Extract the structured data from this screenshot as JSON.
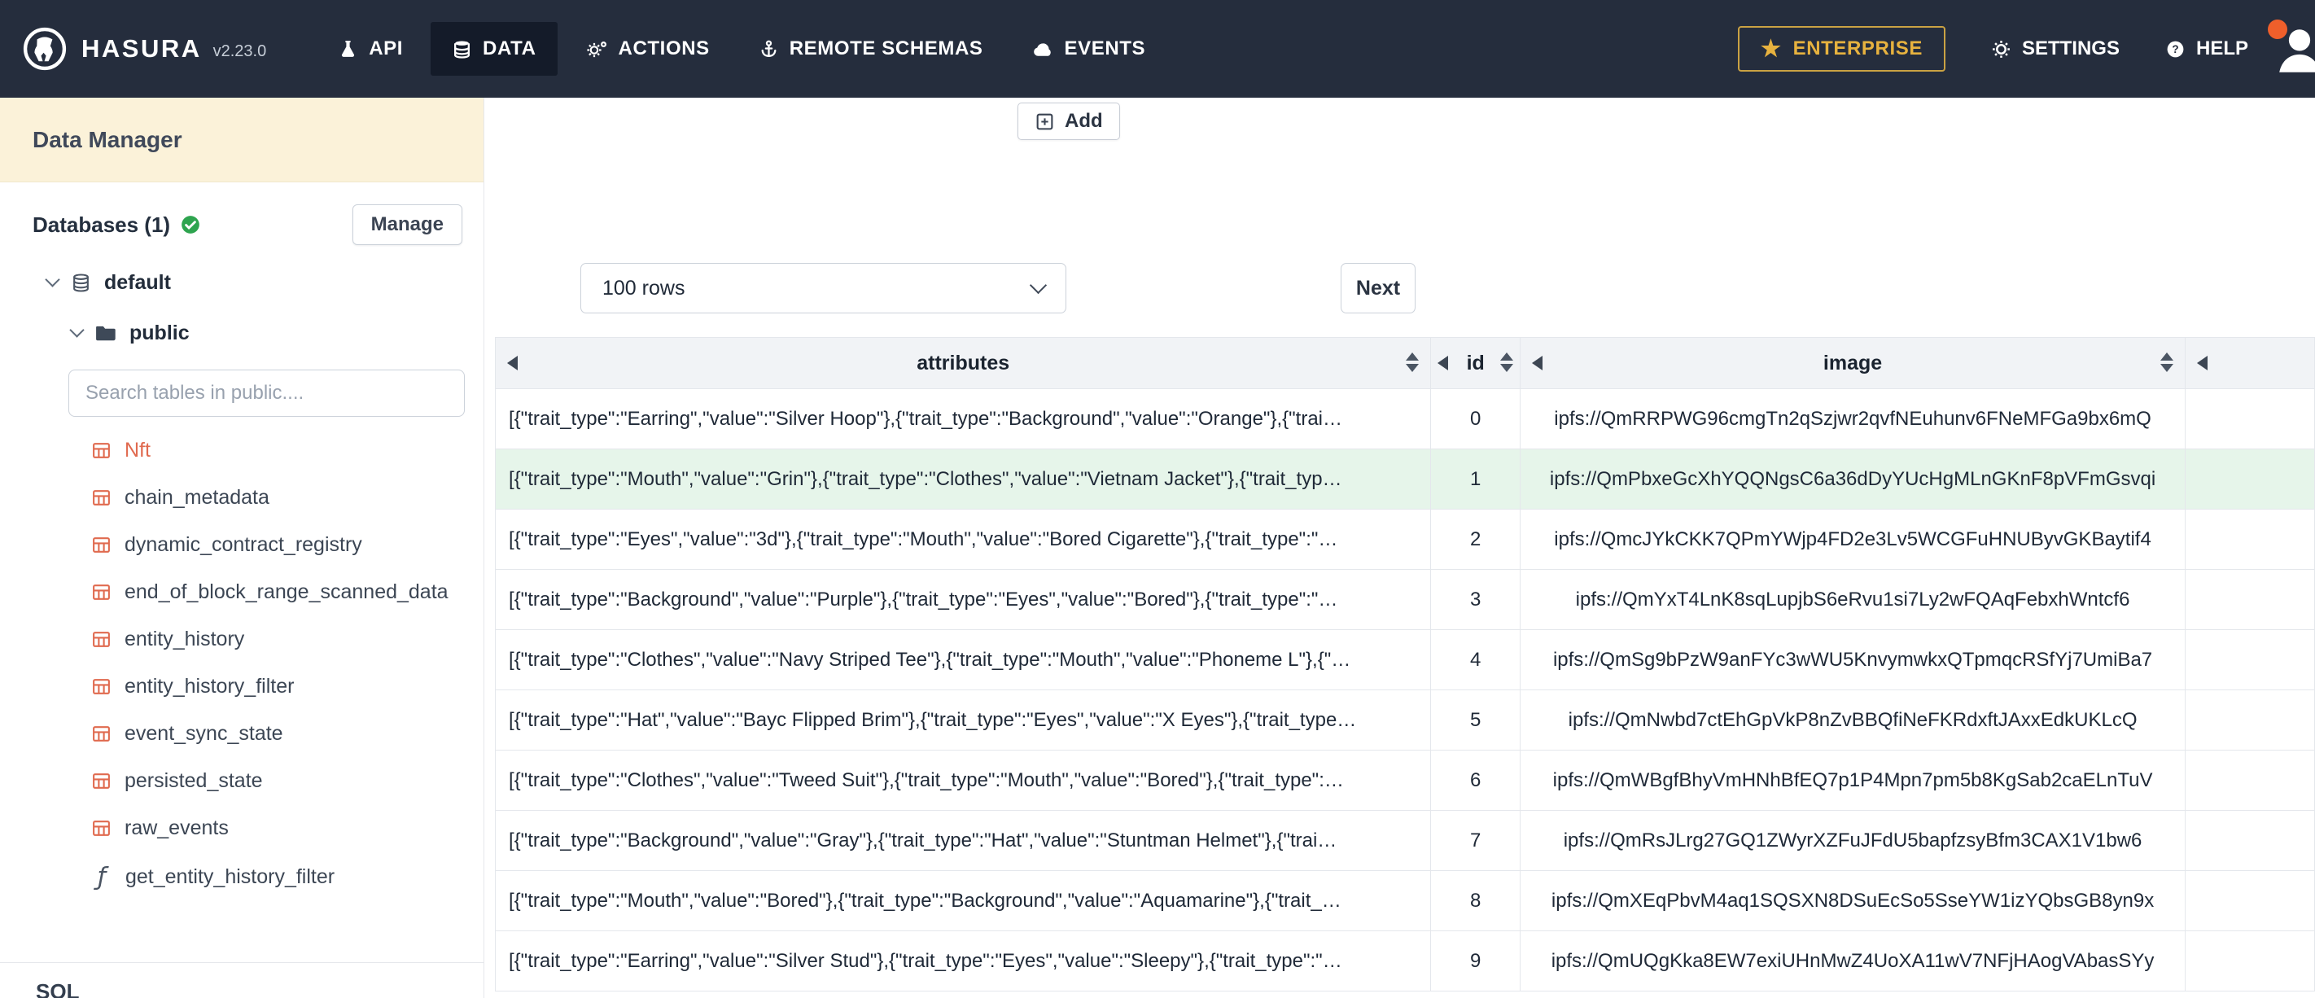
{
  "navbar": {
    "brand": "HASURA",
    "version": "v2.23.0",
    "items": [
      {
        "label": "API"
      },
      {
        "label": "DATA"
      },
      {
        "label": "ACTIONS"
      },
      {
        "label": "REMOTE SCHEMAS"
      },
      {
        "label": "EVENTS"
      }
    ],
    "enterprise": "ENTERPRISE",
    "settings": "SETTINGS",
    "help": "HELP"
  },
  "sidebar": {
    "title": "Data Manager",
    "databases_label": "Databases (1)",
    "manage_button": "Manage",
    "database_name": "default",
    "schema_name": "public",
    "search_placeholder": "Search tables in public....",
    "tables": [
      {
        "name": "Nft",
        "active": true
      },
      {
        "name": "chain_metadata"
      },
      {
        "name": "dynamic_contract_registry"
      },
      {
        "name": "end_of_block_range_scanned_data"
      },
      {
        "name": "entity_history"
      },
      {
        "name": "entity_history_filter"
      },
      {
        "name": "event_sync_state"
      },
      {
        "name": "persisted_state"
      },
      {
        "name": "raw_events"
      }
    ],
    "function_glyph": "ƒ",
    "function_name": "get_entity_history_filter",
    "sql_label": "SQL"
  },
  "content": {
    "add_button": "Add",
    "rows_per_page": "100 rows",
    "next_button": "Next",
    "table": {
      "columns": [
        "attributes",
        "id",
        "image"
      ],
      "highlighted_row_id": "1",
      "rows": [
        {
          "attributes": "[{\"trait_type\":\"Earring\",\"value\":\"Silver Hoop\"},{\"trait_type\":\"Background\",\"value\":\"Orange\"},{\"trai…",
          "id": "0",
          "image": "ipfs://QmRRPWG96cmgTn2qSzjwr2qvfNEuhunv6FNeMFGa9bx6mQ"
        },
        {
          "attributes": "[{\"trait_type\":\"Mouth\",\"value\":\"Grin\"},{\"trait_type\":\"Clothes\",\"value\":\"Vietnam Jacket\"},{\"trait_typ…",
          "id": "1",
          "image": "ipfs://QmPbxeGcXhYQQNgsC6a36dDyYUcHgMLnGKnF8pVFmGsvqi"
        },
        {
          "attributes": "[{\"trait_type\":\"Eyes\",\"value\":\"3d\"},{\"trait_type\":\"Mouth\",\"value\":\"Bored Cigarette\"},{\"trait_type\":\"…",
          "id": "2",
          "image": "ipfs://QmcJYkCKK7QPmYWjp4FD2e3Lv5WCGFuHNUByvGKBaytif4"
        },
        {
          "attributes": "[{\"trait_type\":\"Background\",\"value\":\"Purple\"},{\"trait_type\":\"Eyes\",\"value\":\"Bored\"},{\"trait_type\":\"…",
          "id": "3",
          "image": "ipfs://QmYxT4LnK8sqLupjbS6eRvu1si7Ly2wFQAqFebxhWntcf6"
        },
        {
          "attributes": "[{\"trait_type\":\"Clothes\",\"value\":\"Navy Striped Tee\"},{\"trait_type\":\"Mouth\",\"value\":\"Phoneme L\"},{\"…",
          "id": "4",
          "image": "ipfs://QmSg9bPzW9anFYc3wWU5KnvymwkxQTpmqcRSfYj7UmiBa7"
        },
        {
          "attributes": "[{\"trait_type\":\"Hat\",\"value\":\"Bayc Flipped Brim\"},{\"trait_type\":\"Eyes\",\"value\":\"X Eyes\"},{\"trait_type…",
          "id": "5",
          "image": "ipfs://QmNwbd7ctEhGpVkP8nZvBBQfiNeFKRdxftJAxxEdkUKLcQ"
        },
        {
          "attributes": "[{\"trait_type\":\"Clothes\",\"value\":\"Tweed Suit\"},{\"trait_type\":\"Mouth\",\"value\":\"Bored\"},{\"trait_type\":…",
          "id": "6",
          "image": "ipfs://QmWBgfBhyVmHNhBfEQ7p1P4Mpn7pm5b8KgSab2caELnTuV"
        },
        {
          "attributes": "[{\"trait_type\":\"Background\",\"value\":\"Gray\"},{\"trait_type\":\"Hat\",\"value\":\"Stuntman Helmet\"},{\"trai…",
          "id": "7",
          "image": "ipfs://QmRsJLrg27GQ1ZWyrXZFuJFdU5bapfzsyBfm3CAX1V1bw6"
        },
        {
          "attributes": "[{\"trait_type\":\"Mouth\",\"value\":\"Bored\"},{\"trait_type\":\"Background\",\"value\":\"Aquamarine\"},{\"trait_…",
          "id": "8",
          "image": "ipfs://QmXEqPbvM4aq1SQSXN8DSuEcSo5SseYW1izYQbsGB8yn9x"
        },
        {
          "attributes": "[{\"trait_type\":\"Earring\",\"value\":\"Silver Stud\"},{\"trait_type\":\"Eyes\",\"value\":\"Sleepy\"},{\"trait_type\":\"…",
          "id": "9",
          "image": "ipfs://QmUQgKka8EW7exiUHnMwZ4UoXA11wV7NFjHAogVAbasSYy"
        }
      ]
    }
  },
  "colors": {
    "nav_bg": "#252d3d",
    "accent_orange": "#e06a4f",
    "enterprise_gold": "#e7b23f",
    "row_highlight_green": "#e6f5ea",
    "check_green": "#2ea44f"
  }
}
